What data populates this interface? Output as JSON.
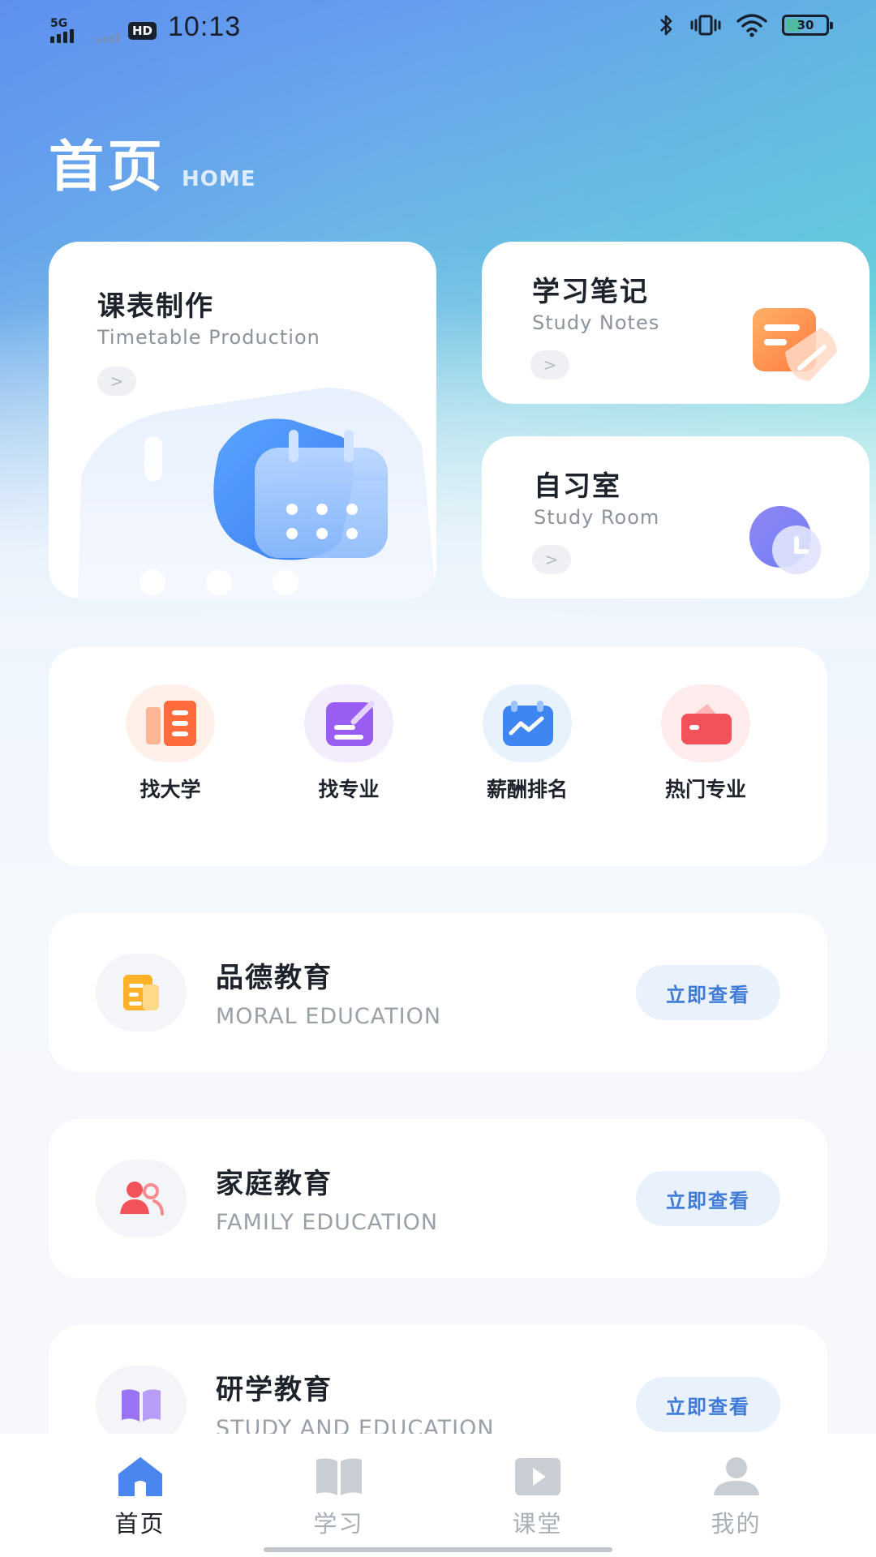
{
  "status_bar": {
    "network": "5G",
    "hd": "HD",
    "time": "10:13",
    "battery": "30"
  },
  "header": {
    "title": "首页",
    "subtitle": "HOME"
  },
  "feature_cards": {
    "timetable": {
      "title": "课表制作",
      "subtitle": "Timetable Production",
      "arrow": ">"
    },
    "notes": {
      "title": "学习笔记",
      "subtitle": "Study Notes",
      "arrow": ">"
    },
    "room": {
      "title": "自习室",
      "subtitle": "Study Room",
      "arrow": ">"
    }
  },
  "quick_nav": [
    {
      "label": "找大学",
      "icon": "university-list-icon"
    },
    {
      "label": "找专业",
      "icon": "major-edit-icon"
    },
    {
      "label": "薪酬排名",
      "icon": "salary-chart-icon"
    },
    {
      "label": "热门专业",
      "icon": "popular-wallet-icon"
    }
  ],
  "edu_list": [
    {
      "title": "品德教育",
      "subtitle": "MORAL EDUCATION",
      "button": "立即查看",
      "icon": "document-icon"
    },
    {
      "title": "家庭教育",
      "subtitle": "FAMILY EDUCATION",
      "button": "立即查看",
      "icon": "family-icon"
    },
    {
      "title": "研学教育",
      "subtitle": "STUDY AND EDUCATION",
      "button": "立即查看",
      "icon": "book-icon"
    }
  ],
  "tabs": [
    {
      "label": "首页",
      "active": true
    },
    {
      "label": "学习",
      "active": false
    },
    {
      "label": "课堂",
      "active": false
    },
    {
      "label": "我的",
      "active": false
    }
  ],
  "colors": {
    "accent": "#3f7ad8",
    "tab_active_icon": "#4a86ee",
    "tab_inactive": "#c9ced4"
  }
}
